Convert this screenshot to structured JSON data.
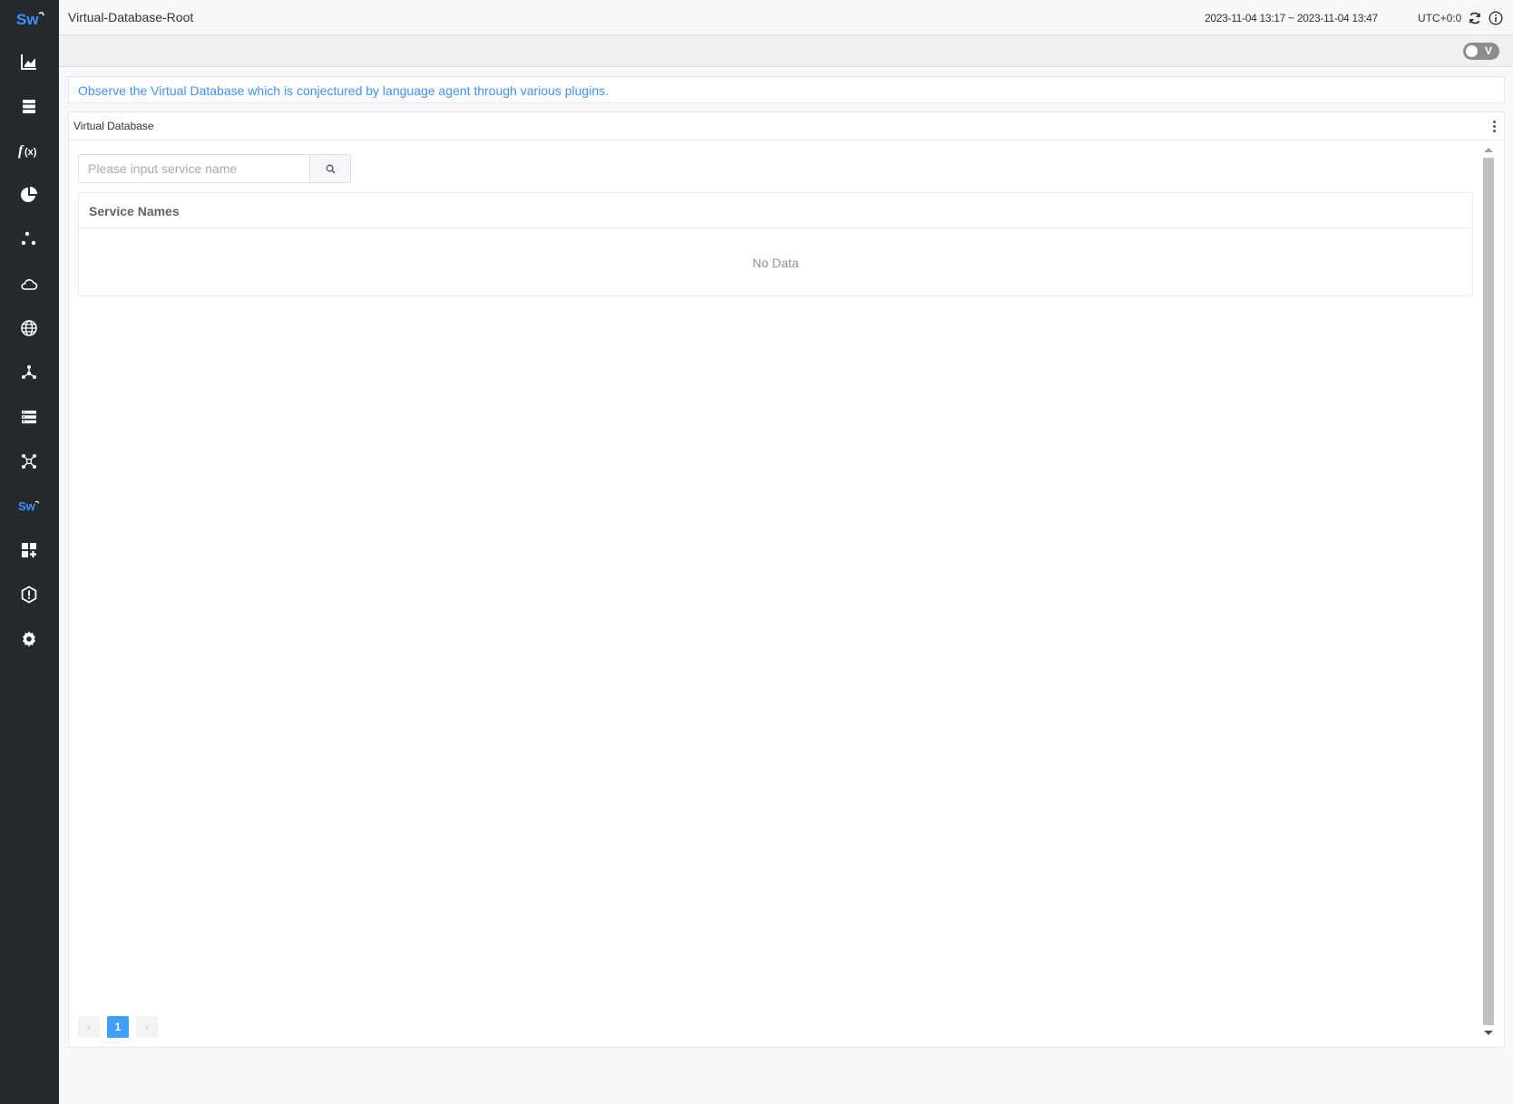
{
  "app": {
    "logo_text": "Sw",
    "accent": "#3d92ff",
    "sidebar_bg": "#252a2f"
  },
  "sidebar": {
    "items": [
      {
        "icon": "line-chart-icon",
        "name": "General Service"
      },
      {
        "icon": "database-icon",
        "name": "Database"
      },
      {
        "icon": "function-icon",
        "name": "Functions"
      },
      {
        "icon": "pie-chart-icon",
        "name": "Self Observability"
      },
      {
        "icon": "nodes-icon",
        "name": "Mesh"
      },
      {
        "icon": "cloud-icon",
        "name": "Kubernetes"
      },
      {
        "icon": "globe-icon",
        "name": "Browser"
      },
      {
        "icon": "network-icon",
        "name": "Infrastructure"
      },
      {
        "icon": "list-icon",
        "name": "Gateway"
      },
      {
        "icon": "topology-icon",
        "name": "Topology"
      },
      {
        "icon": "sw-logo-icon",
        "name": "SkyWalking"
      },
      {
        "icon": "dashboard-add-icon",
        "name": "Dashboards"
      },
      {
        "icon": "alarm-icon",
        "name": "Alerting"
      },
      {
        "icon": "settings-icon",
        "name": "Settings"
      }
    ]
  },
  "header": {
    "title": "Virtual-Database-Root",
    "time_range": "2023-11-04 13:17 ~ 2023-11-04 13:47",
    "timezone": "UTC+0:0"
  },
  "toolbar": {
    "toggle_label": "V",
    "toggle_on": false
  },
  "notice": {
    "text": "Observe the Virtual Database which is conjectured by language agent through various plugins."
  },
  "panel": {
    "title": "Virtual Database",
    "search": {
      "placeholder": "Please input service name",
      "value": ""
    },
    "table": {
      "columns": [
        "Service Names"
      ],
      "rows": [],
      "empty_text": "No Data"
    },
    "pagination": {
      "prev": "‹",
      "current": "1",
      "next": "›"
    }
  }
}
